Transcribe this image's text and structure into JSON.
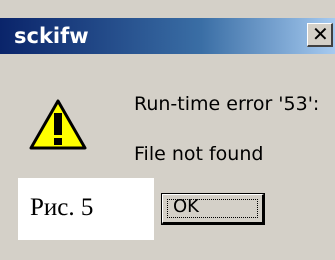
{
  "window": {
    "title": "sckifw",
    "close_glyph": "✕"
  },
  "dialog": {
    "icon": "warning-icon",
    "icon_colors": {
      "fill": "#ffff00",
      "outline": "#000000",
      "mark": "#000000"
    },
    "message_line_1": "Run-time error '53':",
    "message_line_2": "File not found",
    "ok_label": "OK"
  },
  "caption": {
    "text": "Рис. 5"
  },
  "colors": {
    "dialog_bg": "#d4d0c8",
    "title_bar_start": "#0a246a",
    "title_bar_end": "#a6caf0",
    "title_text": "#ffffff"
  }
}
